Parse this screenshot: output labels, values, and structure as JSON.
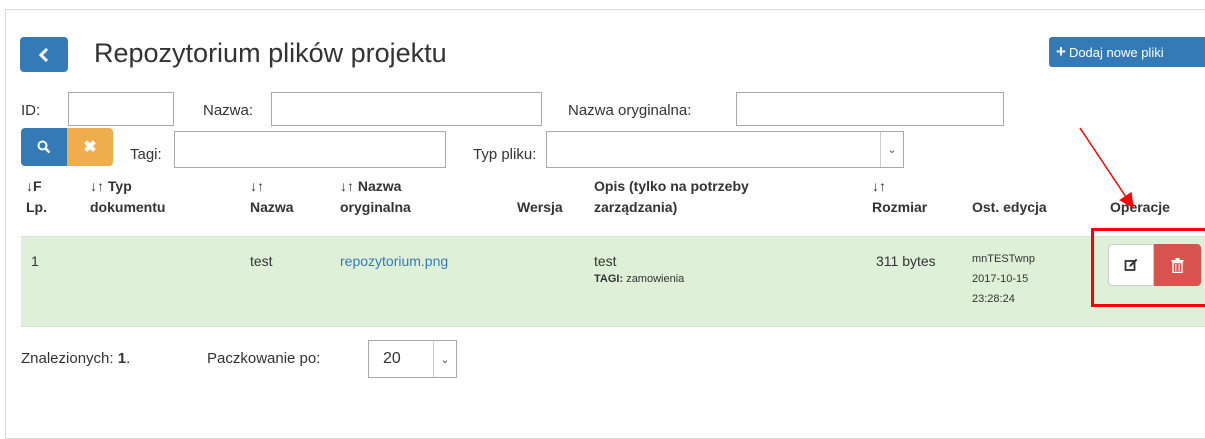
{
  "header": {
    "back_icon": "chevron-left-icon",
    "title": "Repozytorium plików projektu",
    "add_button_label": "Dodaj nowe pliki"
  },
  "filters": {
    "id_label": "ID:",
    "id_value": "",
    "name_label": "Nazwa:",
    "name_value": "",
    "original_name_label": "Nazwa oryginalna:",
    "original_name_value": "",
    "tags_label": "Tagi:",
    "tags_value": "",
    "file_type_label": "Typ pliku:",
    "file_type_value": ""
  },
  "table": {
    "columns": {
      "lp": "Lp.",
      "doc_type_1": "Typ",
      "doc_type_2": "dokumentu",
      "name": "Nazwa",
      "orig_1": "Nazwa",
      "orig_2": "oryginalna",
      "version": "Wersja",
      "desc_1": "Opis (tylko na potrzeby",
      "desc_2": "zarządzania)",
      "size": "Rozmiar",
      "last_edit": "Ost. edycja",
      "operations": "Operacje"
    },
    "rows": [
      {
        "lp": "1",
        "doc_type": "",
        "name": "test",
        "original_name": "repozytorium.png",
        "version": "",
        "description": "test",
        "tags_label": "TAGI:",
        "tags": "zamowienia",
        "size": "311 bytes",
        "editor": "mnTESTwnp",
        "edit_date": "2017-10-15",
        "edit_time": "23:28:24"
      }
    ]
  },
  "footer": {
    "found_label": "Znalezionych:",
    "found_count": "1",
    "found_suffix": ".",
    "paging_label": "Paczkowanie po:",
    "paging_value": "20"
  },
  "colors": {
    "primary": "#337ab7",
    "warning": "#f0ad4e",
    "danger": "#d9534f",
    "row_highlight": "#dff0d8",
    "annotation": "#ff0000"
  }
}
